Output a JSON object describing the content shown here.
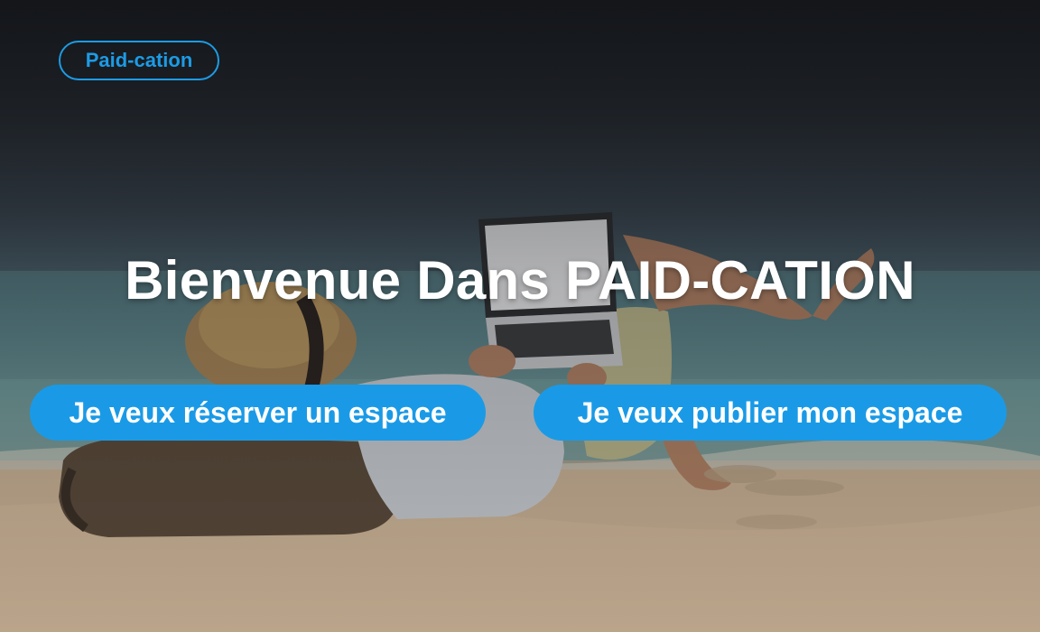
{
  "brand": {
    "label": "Paid-cation"
  },
  "hero": {
    "headline": "Bienvenue Dans PAID-CATION",
    "background_description_icon": "beach-laptop-photo"
  },
  "actions": {
    "book_label": "Je veux réserver un espace",
    "publish_label": "Je veux publier mon espace"
  },
  "colors": {
    "accent": "#1a9ae6",
    "headline": "#ffffff"
  }
}
